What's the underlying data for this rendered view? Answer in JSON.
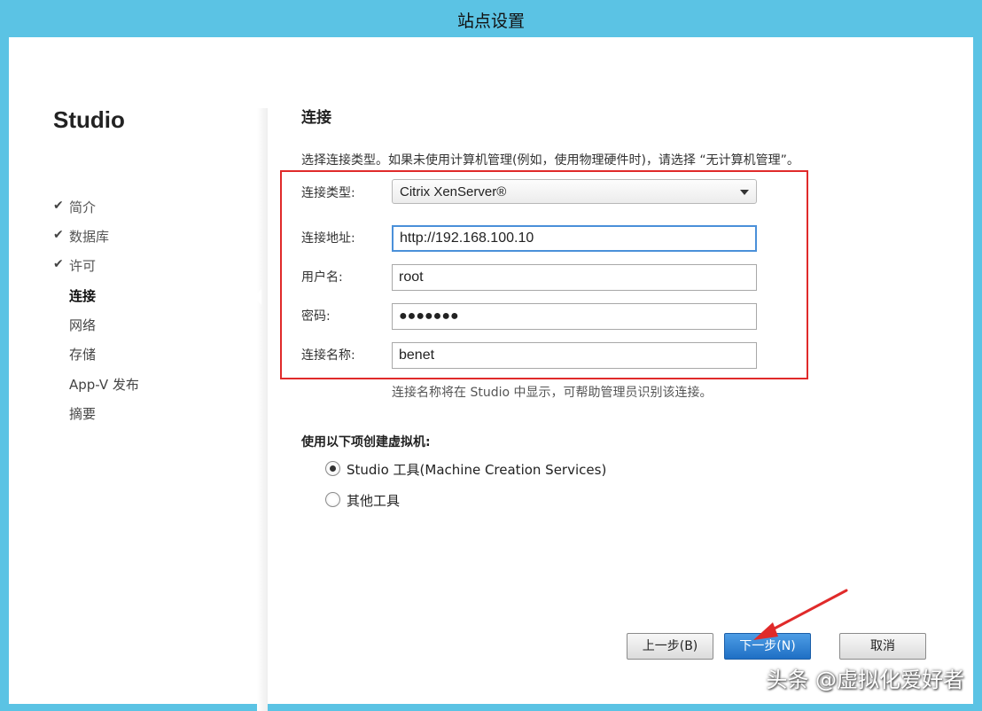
{
  "window": {
    "title": "站点设置"
  },
  "sidebar": {
    "brand": "Studio",
    "items": [
      {
        "label": "简介",
        "state": "done"
      },
      {
        "label": "数据库",
        "state": "done"
      },
      {
        "label": "许可",
        "state": "done"
      },
      {
        "label": "连接",
        "state": "current"
      },
      {
        "label": "网络",
        "state": "pending"
      },
      {
        "label": "存储",
        "state": "pending"
      },
      {
        "label": "App-V 发布",
        "state": "pending"
      },
      {
        "label": "摘要",
        "state": "pending"
      }
    ]
  },
  "main": {
    "heading": "连接",
    "description": "选择连接类型。如果未使用计算机管理(例如，使用物理硬件时)，请选择 “无计算机管理”。",
    "fields": {
      "connection_type": {
        "label": "连接类型:",
        "value": "Citrix XenServer®"
      },
      "connection_address": {
        "label": "连接地址:",
        "value": "http://192.168.100.10"
      },
      "username": {
        "label": "用户名:",
        "value": "root"
      },
      "password": {
        "label": "密码:",
        "value": "●●●●●●●"
      },
      "connection_name": {
        "label": "连接名称:",
        "value": "benet"
      }
    },
    "hint": "连接名称将在 Studio 中显示，可帮助管理员识别该连接。",
    "vm_section": {
      "label": "使用以下项创建虚拟机:",
      "options": [
        {
          "label": "Studio 工具(Machine Creation Services)",
          "checked": true
        },
        {
          "label": "其他工具",
          "checked": false
        }
      ]
    }
  },
  "footer": {
    "back": "上一步(B)",
    "next": "下一步(N)",
    "cancel": "取消"
  },
  "watermark": "头条 @虚拟化爱好者",
  "colors": {
    "accent": "#5bc3e4",
    "highlight": "#e02a2a",
    "primary_button": "#2a7fd4"
  }
}
